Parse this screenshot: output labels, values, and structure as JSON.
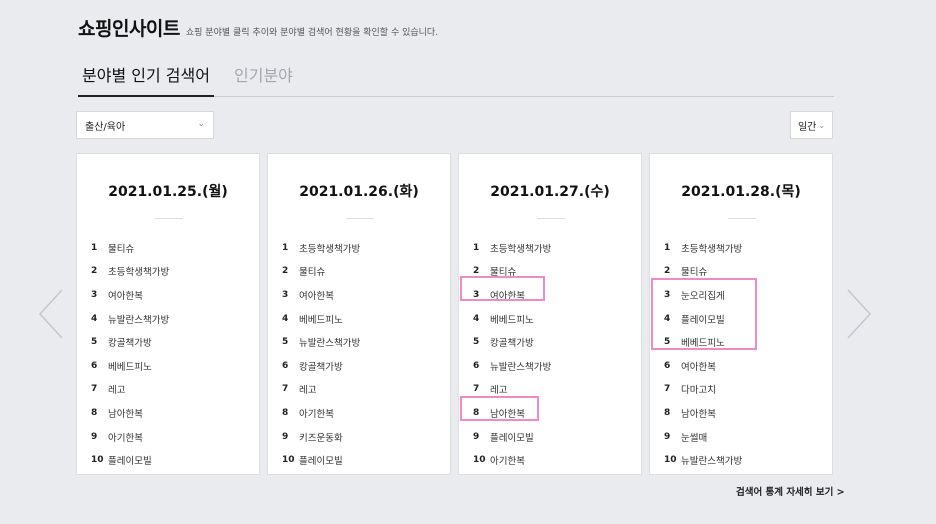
{
  "header": {
    "title": "쇼핑인사이트",
    "description": "쇼핑 분야별 클릭 추이와 분야별 검색어 현황을 확인할 수 있습니다."
  },
  "tabs": [
    {
      "label": "분야별 인기 검색어",
      "active": true
    },
    {
      "label": "인기분야",
      "active": false
    }
  ],
  "filters": {
    "category": "출산/육아",
    "period": "일간"
  },
  "icons": {
    "prev": "chevron-left-icon",
    "next": "chevron-right-icon",
    "dropdown": "chevron-down-icon"
  },
  "colors": {
    "highlight": "#ee8ac6",
    "background": "#e9ebef"
  },
  "cards": [
    {
      "date": "2021.01.25.(월)",
      "ranks": [
        {
          "num": "1",
          "keyword": "물티슈"
        },
        {
          "num": "2",
          "keyword": "초등학생책가방"
        },
        {
          "num": "3",
          "keyword": "여아한복"
        },
        {
          "num": "4",
          "keyword": "뉴발란스책가방"
        },
        {
          "num": "5",
          "keyword": "캉골책가방"
        },
        {
          "num": "6",
          "keyword": "베베드피노"
        },
        {
          "num": "7",
          "keyword": "레고"
        },
        {
          "num": "8",
          "keyword": "남아한복"
        },
        {
          "num": "9",
          "keyword": "아기한복"
        },
        {
          "num": "10",
          "keyword": "플레이모빌"
        }
      ]
    },
    {
      "date": "2021.01.26.(화)",
      "ranks": [
        {
          "num": "1",
          "keyword": "초등학생책가방"
        },
        {
          "num": "2",
          "keyword": "물티슈"
        },
        {
          "num": "3",
          "keyword": "여아한복"
        },
        {
          "num": "4",
          "keyword": "베베드피노"
        },
        {
          "num": "5",
          "keyword": "뉴발란스책가방"
        },
        {
          "num": "6",
          "keyword": "캉골책가방"
        },
        {
          "num": "7",
          "keyword": "레고"
        },
        {
          "num": "8",
          "keyword": "아기한복"
        },
        {
          "num": "9",
          "keyword": "키즈운동화"
        },
        {
          "num": "10",
          "keyword": "플레이모빌"
        }
      ]
    },
    {
      "date": "2021.01.27.(수)",
      "ranks": [
        {
          "num": "1",
          "keyword": "초등학생책가방"
        },
        {
          "num": "2",
          "keyword": "물티슈"
        },
        {
          "num": "3",
          "keyword": "여아한복"
        },
        {
          "num": "4",
          "keyword": "베베드피노"
        },
        {
          "num": "5",
          "keyword": "캉골책가방"
        },
        {
          "num": "6",
          "keyword": "뉴발란스책가방"
        },
        {
          "num": "7",
          "keyword": "레고"
        },
        {
          "num": "8",
          "keyword": "남아한복"
        },
        {
          "num": "9",
          "keyword": "플레이모빌"
        },
        {
          "num": "10",
          "keyword": "아기한복"
        }
      ]
    },
    {
      "date": "2021.01.28.(목)",
      "ranks": [
        {
          "num": "1",
          "keyword": "초등학생책가방"
        },
        {
          "num": "2",
          "keyword": "물티슈"
        },
        {
          "num": "3",
          "keyword": "눈오리집게"
        },
        {
          "num": "4",
          "keyword": "플레이모빌"
        },
        {
          "num": "5",
          "keyword": "베베드피노"
        },
        {
          "num": "6",
          "keyword": "여아한복"
        },
        {
          "num": "7",
          "keyword": "다마고치"
        },
        {
          "num": "8",
          "keyword": "남아한복"
        },
        {
          "num": "9",
          "keyword": "눈썰매"
        },
        {
          "num": "10",
          "keyword": "뉴발란스책가방"
        }
      ]
    }
  ],
  "footer": {
    "more_link": "검색어 통계 자세히 보기 >"
  }
}
